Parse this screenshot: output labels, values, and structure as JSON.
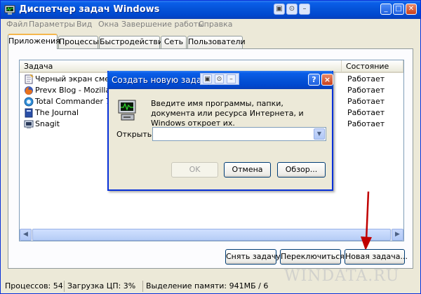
{
  "window": {
    "title": "Диспетчер задач Windows"
  },
  "menu": [
    "Файл",
    "Параметры",
    "Вид",
    "Окна",
    "Завершение работы",
    "Справка"
  ],
  "tabs": [
    "Приложения",
    "Процессы",
    "Быстродействие",
    "Сеть",
    "Пользователи"
  ],
  "list": {
    "col_task": "Задача",
    "col_status": "Состояние",
    "rows": [
      {
        "name": "Черный экран смерти",
        "status": "Работает",
        "icon": "notepad-icon"
      },
      {
        "name": "Prevx Blog - Mozilla Fire",
        "status": "Работает",
        "icon": "firefox-icon"
      },
      {
        "name": "Total Commander 7.50a",
        "status": "Работает",
        "icon": "totalcmd-icon"
      },
      {
        "name": "The Journal",
        "status": "Работает",
        "icon": "journal-icon"
      },
      {
        "name": "Snagit",
        "status": "Работает",
        "icon": "snagit-icon"
      }
    ]
  },
  "buttons": {
    "end_task": "Снять задачу",
    "switch_to": "Переключиться",
    "new_task": "Новая задача..."
  },
  "statusbar": {
    "processes": "Процессов: 54",
    "cpu": "Загрузка ЦП: 3%",
    "memory": "Выделение памяти: 941МБ / 6"
  },
  "watermark": "WINDATA.RU",
  "dialog": {
    "title": "Создать новую задачу",
    "help": "?",
    "close": "×",
    "description": "Введите имя программы, папки, документа или ресурса Интернета, и Windows откроет их.",
    "open_label": "Открыть:",
    "open_value": "",
    "ok": "OK",
    "cancel": "Отмена",
    "browse": "Обзор..."
  },
  "colors": {
    "titlebar": "#0553d8",
    "window_bg": "#ece9d8",
    "arrow": "#c00000"
  }
}
